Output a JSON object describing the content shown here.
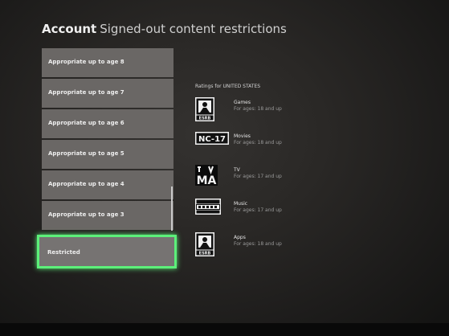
{
  "header": {
    "section": "Account",
    "title": "Signed-out content restrictions"
  },
  "menu": {
    "items": [
      {
        "label": "Appropriate up to age 8"
      },
      {
        "label": "Appropriate up to age 7"
      },
      {
        "label": "Appropriate up to age 6"
      },
      {
        "label": "Appropriate up to age 5"
      },
      {
        "label": "Appropriate up to age 4"
      },
      {
        "label": "Appropriate up to age 3"
      },
      {
        "label": "Restricted"
      }
    ],
    "selected_index": 6,
    "selected_color": "#5cf07a"
  },
  "ratings": {
    "title": "Ratings for UNITED STATES",
    "items": [
      {
        "category": "Games",
        "detail": "For ages: 18 and up",
        "icon": "esrb-ao-icon",
        "badge_text": "ESRB"
      },
      {
        "category": "Movies",
        "detail": "For ages: 18 and up",
        "icon": "mpaa-nc17-icon",
        "badge_text": "NC-17"
      },
      {
        "category": "TV",
        "detail": "For ages: 17 and up",
        "icon": "tv-ma-icon",
        "badge_text": "MA"
      },
      {
        "category": "Music",
        "detail": "For ages: 17 and up",
        "icon": "parental-advisory-icon",
        "badge_text": ""
      },
      {
        "category": "Apps",
        "detail": "For ages: 18 and up",
        "icon": "esrb-ao-icon",
        "badge_text": "ESRB"
      }
    ]
  }
}
